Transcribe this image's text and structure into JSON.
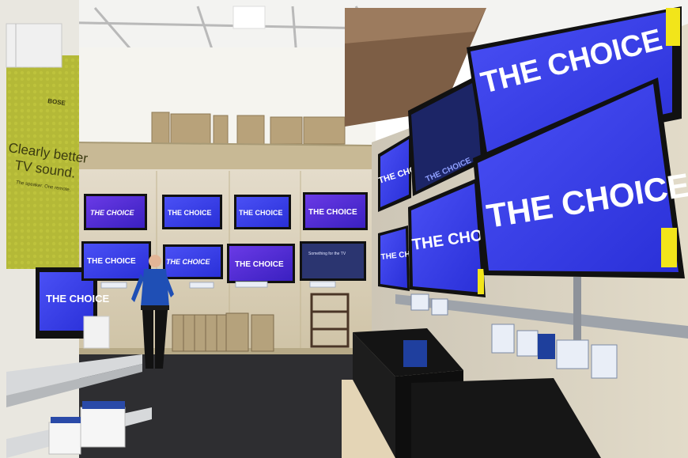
{
  "photo": {
    "tv_slogan": "THE CHOICE",
    "ad_headline_line1": "Clearly better",
    "ad_headline_line2": "TV sound.",
    "ad_subline": "The speaker. One remote.",
    "ad_brand": "BOSE",
    "hud_caption": "Something for the TV"
  },
  "colors": {
    "screen_blue": "#3b42f0",
    "screen_purple": "#5b2fd8",
    "wall_beige": "#d9cfb7",
    "floor": "#2e2e30",
    "ceiling": "#f2f2f0"
  }
}
